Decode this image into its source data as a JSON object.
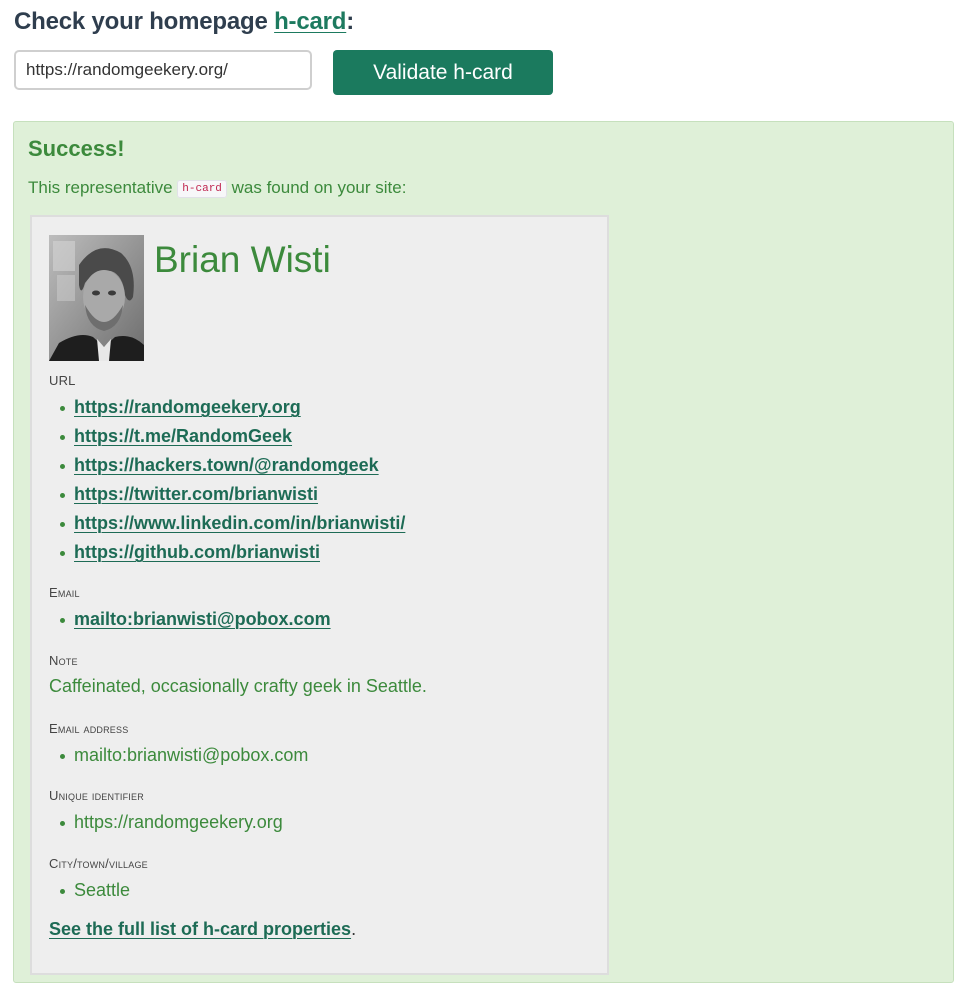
{
  "header": {
    "prefix": "Check your ",
    "bold": "homepage",
    "link": "h-card",
    "suffix": ":"
  },
  "form": {
    "url_value": "https://randomgeekery.org/",
    "validate_label": "Validate h-card"
  },
  "result": {
    "title": "Success!",
    "found_prefix": "This representative ",
    "found_code": "h-card",
    "found_suffix": " was found on your site:"
  },
  "card": {
    "name": "Brian Wisti",
    "url_label": "URL",
    "urls": [
      "https://randomgeekery.org",
      "https://t.me/RandomGeek",
      "https://hackers.town/@randomgeek",
      "https://twitter.com/brianwisti",
      "https://www.linkedin.com/in/brianwisti/",
      "https://github.com/brianwisti"
    ],
    "email_label": "Email",
    "email": "mailto:brianwisti@pobox.com",
    "note_label": "Note",
    "note": "Caffeinated, occasionally crafty geek in Seattle.",
    "email_address_label": "Email address",
    "email_address": "mailto:brianwisti@pobox.com",
    "uid_label": "Unique identifier",
    "uid": "https://randomgeekery.org",
    "locality_label": "City/town/village",
    "locality": "Seattle",
    "full_list_link": "See the full list of h-card properties",
    "full_list_suffix": "."
  }
}
